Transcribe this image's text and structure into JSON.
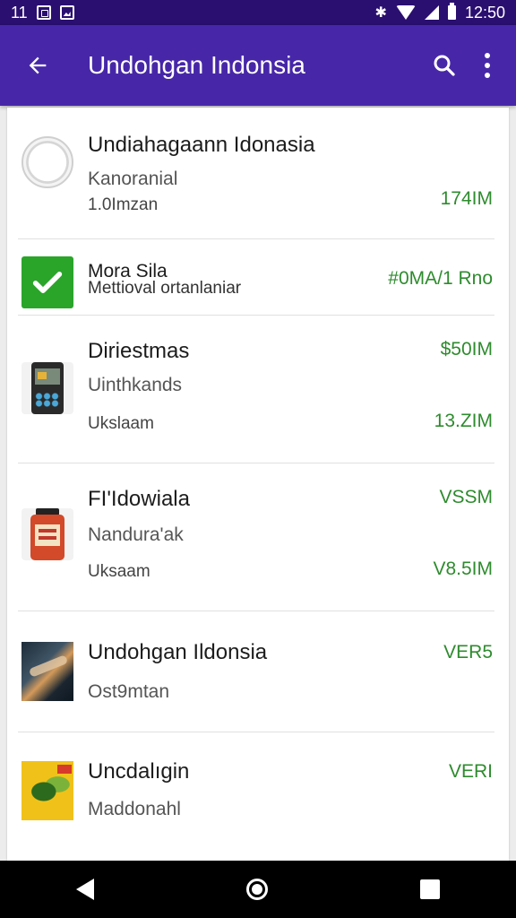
{
  "status_bar": {
    "left_text": "11",
    "time": "12:50"
  },
  "app_bar": {
    "title": "Undohgan Indonsia"
  },
  "items": [
    {
      "title": "Undiahagaann Idonasia",
      "line2": "Kanoranial",
      "line3": "1.0Imzan",
      "value": "174IM",
      "icon": "clock-icon"
    },
    {
      "title": "Mora Sila",
      "line2": "Mettioval ortanlaniar",
      "value": "#0MA/1 Rno",
      "icon": "checkmark-icon"
    },
    {
      "title": "Diriestmas",
      "line2": "Uinthkands",
      "line3": "Ukslaam",
      "value": "$50IM",
      "value2": "13.ZIM",
      "icon": "device-icon"
    },
    {
      "title": "FI'Idowiala",
      "line2": "Nandura'ak",
      "line3": "Uksaam",
      "value": "VSSM",
      "value2": "V8.5IM",
      "icon": "jar-icon"
    },
    {
      "title": "Undohgan Ildonsia",
      "line2": "Ost9mtan",
      "value": "VER5",
      "icon": "photo-icon"
    },
    {
      "title": "Uncdalıgin",
      "line2": "Maddonahl",
      "value": "VERI",
      "icon": "box-icon"
    }
  ],
  "colors": {
    "app_bar": "#4727a8",
    "status_bar": "#2a0f70",
    "value_text": "#2e8b2e"
  }
}
